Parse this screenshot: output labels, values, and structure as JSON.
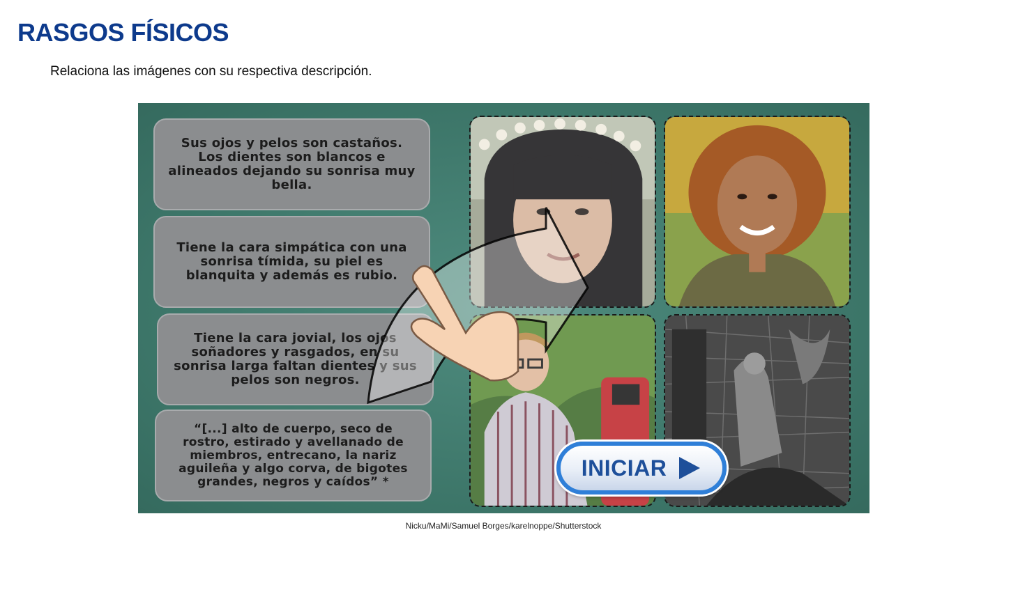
{
  "header": {
    "title": "RASGOS FÍSICOS",
    "instruction": "Relaciona las imágenes con su respectiva descripción."
  },
  "activity": {
    "descriptions": [
      "Sus ojos y pelos son castaños. Los dientes son blancos e alineados dejando su sonrisa muy bella.",
      "Tiene la cara simpática con una sonrisa tímida, su piel es blanquita y además es rubio.",
      "Tiene la cara jovial, los ojos soñadores y rasgados, en su sonrisa larga faltan dientes y sus pelos son negros.",
      "“[...] alto de cuerpo, seco de rostro, estirado y avellanado de miembros, entrecano, la nariz aguileña y algo corva, de bigotes grandes, negros y caídos” *"
    ],
    "images": [
      {
        "icon": "girl-flower-crown-photo"
      },
      {
        "icon": "curly-hair-woman-photo"
      },
      {
        "icon": "smiling-boy-glasses-photo"
      },
      {
        "icon": "don-quixote-engraving"
      }
    ],
    "hint_icons": [
      "curved-arrow-icon",
      "pointing-hand-icon"
    ],
    "start_button": {
      "label": "INICIAR",
      "icon": "play-triangle-icon"
    },
    "colors": {
      "background": "#3f7a6d",
      "card": "#8b8d8f",
      "button_border": "#2f7fd8",
      "title": "#0d3a8c"
    }
  },
  "credit": "Nicku/MaMi/Samuel Borges/karelnoppe/Shutterstock"
}
